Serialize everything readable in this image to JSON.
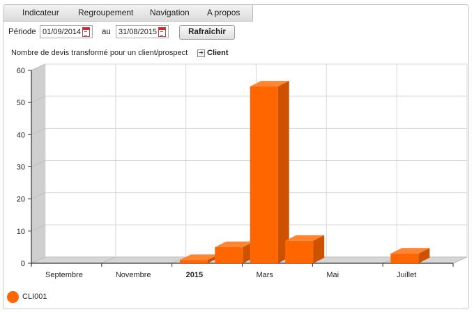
{
  "menu": [
    "Indicateur",
    "Regroupement",
    "Navigation",
    "A propos"
  ],
  "period": {
    "label": "Période",
    "from": "01/09/2014",
    "to_label": "au",
    "to": "31/08/2015",
    "refresh_label": "Rafraîchir"
  },
  "chart_header": {
    "subtitle": "Nombre de devis transformé pour un client/prospect",
    "link_label": "Client"
  },
  "legend": {
    "label": "CLI001",
    "color": "#ff6600"
  },
  "chart_data": {
    "type": "bar",
    "x_tick_labels": [
      "Septembre",
      "Novembre",
      "2015",
      "Mars",
      "Mai",
      "Juillet"
    ],
    "y_ticks": [
      0,
      10,
      20,
      30,
      40,
      50,
      60
    ],
    "ylim": [
      0,
      60
    ],
    "grid": true,
    "categories": [
      "2014-09",
      "2014-10",
      "2014-11",
      "2014-12",
      "2015-01",
      "2015-02",
      "2015-03",
      "2015-04",
      "2015-05",
      "2015-06",
      "2015-07",
      "2015-08"
    ],
    "series": [
      {
        "name": "CLI001",
        "values": [
          0,
          0,
          0,
          0,
          1,
          5,
          55,
          7,
          0,
          0,
          3,
          0
        ]
      }
    ]
  }
}
